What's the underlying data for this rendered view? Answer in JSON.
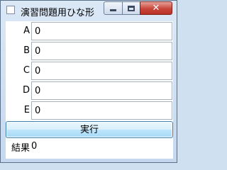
{
  "window": {
    "title": "演習問題用ひな形",
    "minimize_icon": "minimize-icon",
    "maximize_icon": "maximize-icon",
    "close_icon": "close-icon",
    "close_glyph": "✕"
  },
  "fields": [
    {
      "label": "A",
      "value": "0"
    },
    {
      "label": "B",
      "value": "0"
    },
    {
      "label": "C",
      "value": "0"
    },
    {
      "label": "D",
      "value": "0"
    },
    {
      "label": "E",
      "value": "0"
    }
  ],
  "run_button": {
    "label": "実行"
  },
  "result": {
    "label": "結果",
    "value": "0"
  },
  "colors": {
    "close_button": "#c9453a",
    "frame": "#cfe0f1",
    "button_border": "#3c7fb1"
  }
}
